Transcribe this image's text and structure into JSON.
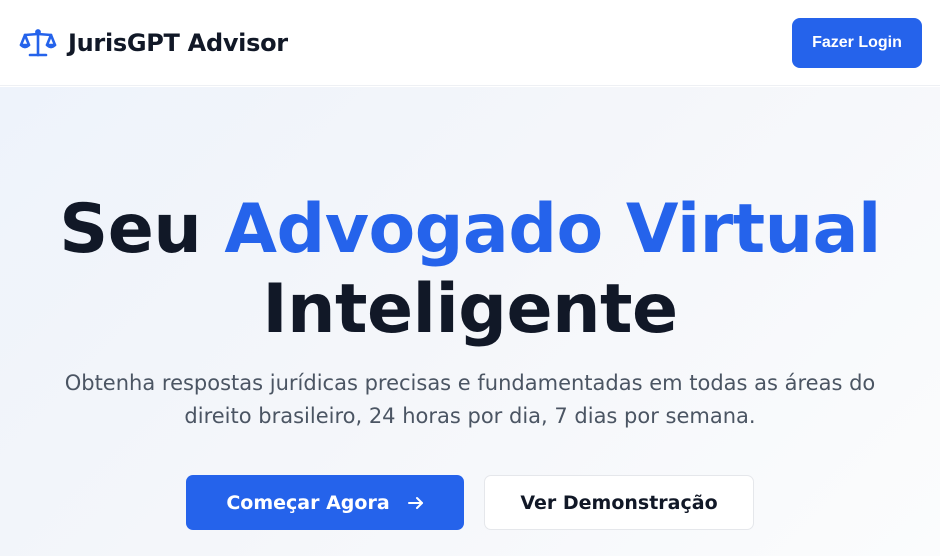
{
  "header": {
    "brand_name": "JurisGPT Advisor",
    "brand_icon": "scale-icon",
    "login_label": "Fazer Login"
  },
  "hero": {
    "title_part1": "Seu ",
    "title_accent": "Advogado Virtual",
    "title_part2": "Inteligente",
    "subtitle_line1": "Obtenha respostas jurídicas precisas e fundamentadas em todas as áreas do",
    "subtitle_line2": "direito brasileiro, 24 horas por dia, 7 dias por semana.",
    "primary_cta": "Começar Agora",
    "primary_cta_icon": "arrow-right-icon",
    "secondary_cta": "Ver Demonstração"
  },
  "colors": {
    "accent": "#2563eb",
    "text_dark": "#111827",
    "text_muted": "#4b5563"
  }
}
